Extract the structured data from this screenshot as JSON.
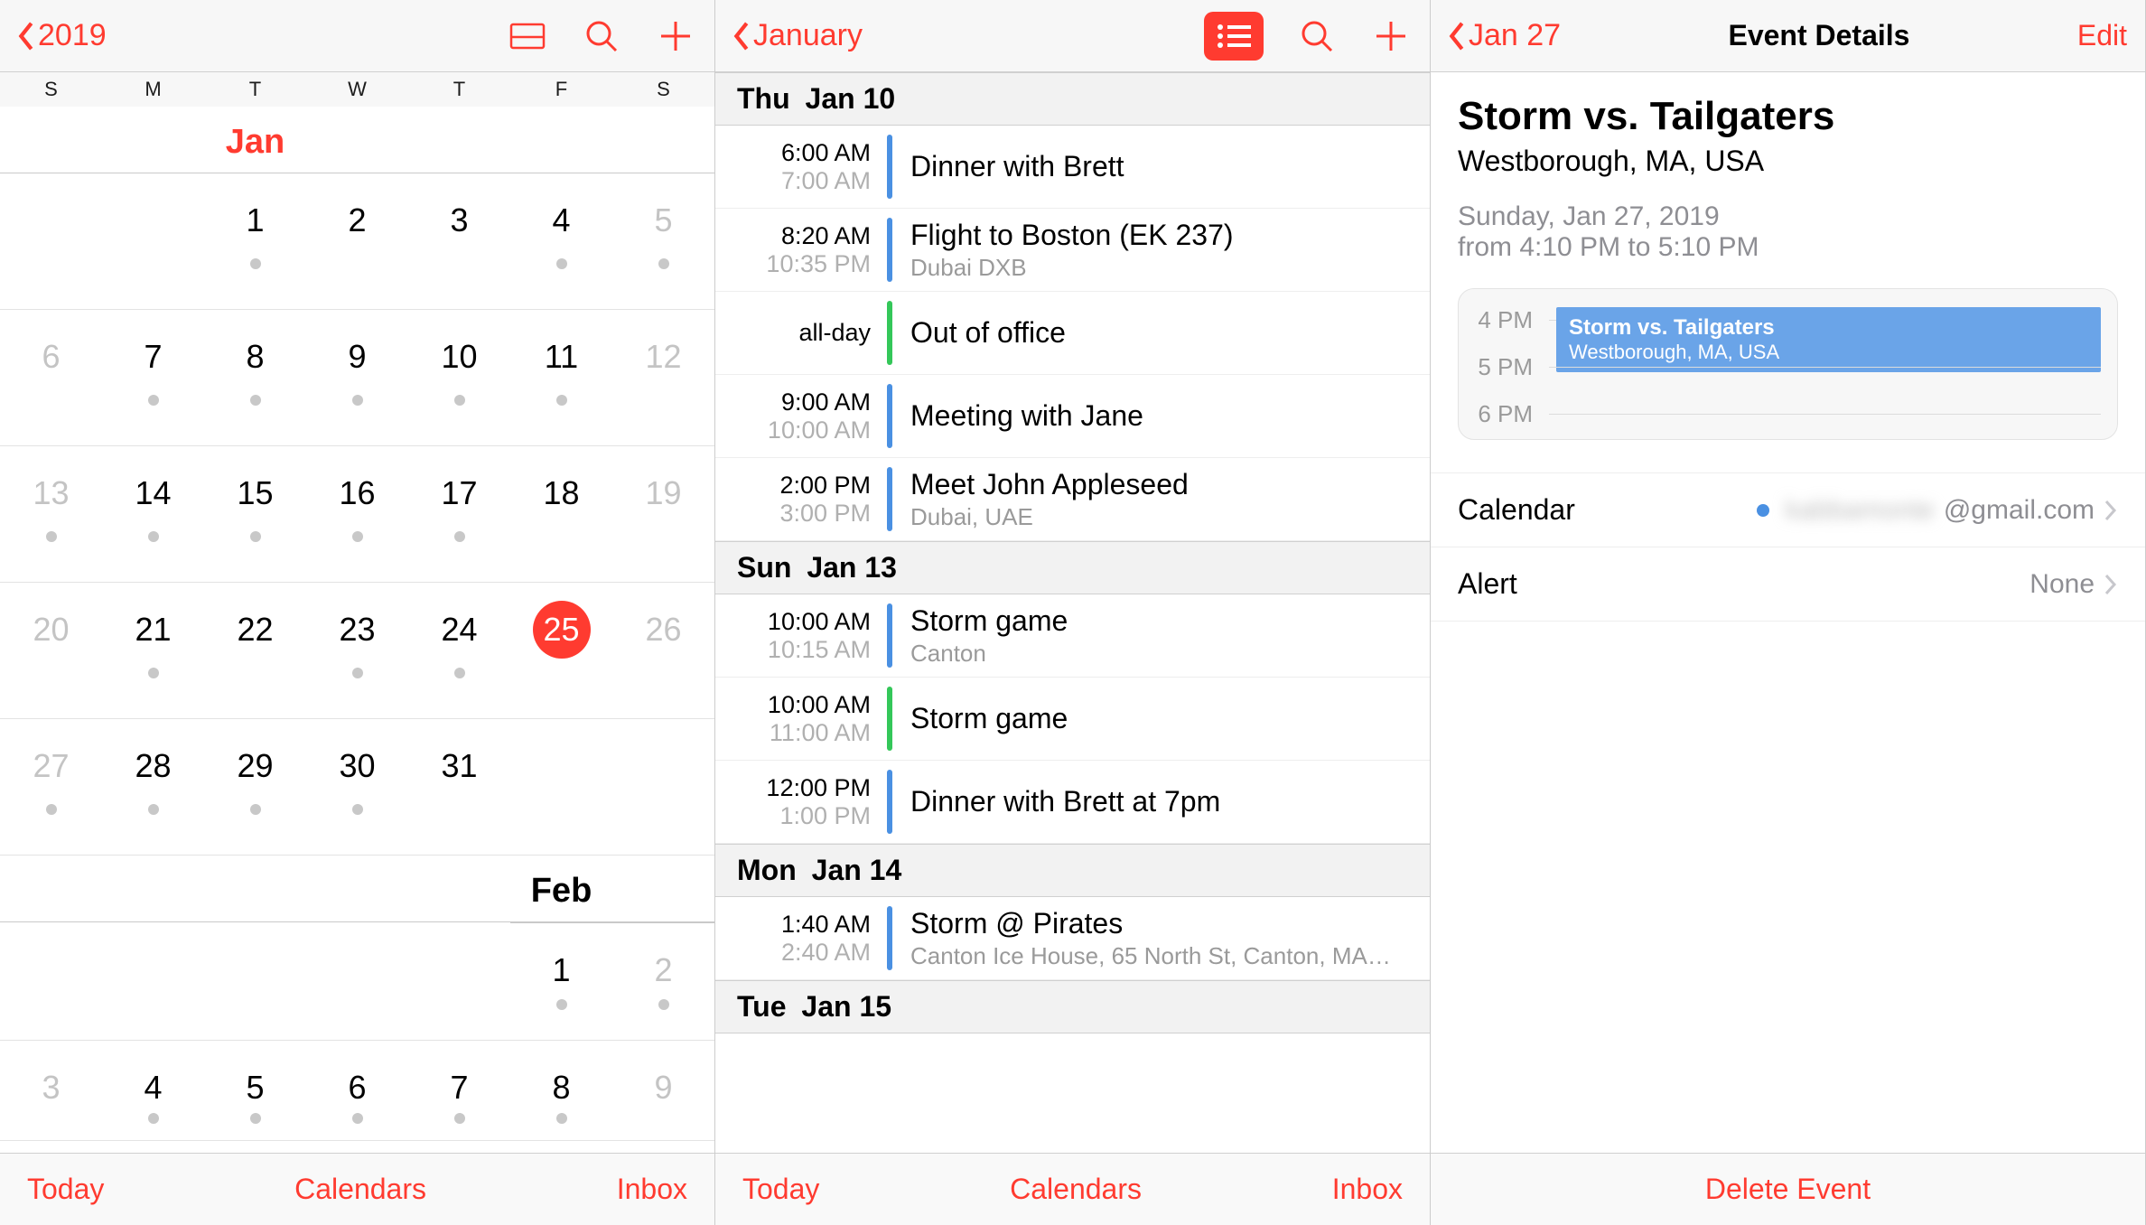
{
  "panel1": {
    "back_label": "2019",
    "weekdays": [
      "S",
      "M",
      "T",
      "W",
      "T",
      "F",
      "S"
    ],
    "month1": "Jan",
    "month2": "Feb",
    "weeks_jan": [
      {
        "offset": 2,
        "days": [
          {
            "n": "1",
            "dot": true
          },
          {
            "n": "2"
          },
          {
            "n": "3"
          },
          {
            "n": "4",
            "dot": true
          },
          {
            "n": "5",
            "gray": true,
            "dot": true
          }
        ]
      },
      {
        "days": [
          {
            "n": "6",
            "gray": true
          },
          {
            "n": "7",
            "dot": true
          },
          {
            "n": "8",
            "dot": true
          },
          {
            "n": "9",
            "dot": true
          },
          {
            "n": "10",
            "dot": true
          },
          {
            "n": "11",
            "dot": true
          },
          {
            "n": "12",
            "gray": true
          }
        ]
      },
      {
        "days": [
          {
            "n": "13",
            "gray": true,
            "dot": true
          },
          {
            "n": "14",
            "dot": true
          },
          {
            "n": "15",
            "dot": true
          },
          {
            "n": "16",
            "dot": true
          },
          {
            "n": "17",
            "dot": true
          },
          {
            "n": "18"
          },
          {
            "n": "19",
            "gray": true
          }
        ]
      },
      {
        "days": [
          {
            "n": "20",
            "gray": true
          },
          {
            "n": "21",
            "dot": true
          },
          {
            "n": "22"
          },
          {
            "n": "23",
            "dot": true
          },
          {
            "n": "24",
            "dot": true
          },
          {
            "n": "25",
            "today": true
          },
          {
            "n": "26",
            "gray": true
          }
        ]
      },
      {
        "days": [
          {
            "n": "27",
            "gray": true,
            "dot": true
          },
          {
            "n": "28",
            "dot": true
          },
          {
            "n": "29",
            "dot": true
          },
          {
            "n": "30",
            "dot": true
          },
          {
            "n": "31"
          }
        ]
      }
    ],
    "weeks_feb": [
      {
        "offset": 5,
        "days": [
          {
            "n": "1",
            "dot": true
          },
          {
            "n": "2",
            "gray": true,
            "dot": true
          }
        ]
      },
      {
        "days": [
          {
            "n": "3",
            "gray": true
          },
          {
            "n": "4",
            "dot": true
          },
          {
            "n": "5",
            "dot": true
          },
          {
            "n": "6",
            "dot": true
          },
          {
            "n": "7",
            "dot": true
          },
          {
            "n": "8",
            "dot": true
          },
          {
            "n": "9",
            "gray": true
          }
        ]
      }
    ],
    "toolbar": {
      "today": "Today",
      "calendars": "Calendars",
      "inbox": "Inbox"
    }
  },
  "panel2": {
    "back_label": "January",
    "days": [
      {
        "dow": "Thu",
        "date": "Jan 10",
        "events": [
          {
            "t1": "6:00 AM",
            "t2": "7:00 AM",
            "color": "blue",
            "title": "Dinner with Brett"
          },
          {
            "t1": "8:20 AM",
            "t2": "10:35 PM",
            "color": "blue",
            "title": "Flight to Boston (EK 237)",
            "loc": "Dubai DXB"
          },
          {
            "t1": "all-day",
            "t2": "",
            "color": "green",
            "title": "Out of office"
          },
          {
            "t1": "9:00 AM",
            "t2": "10:00 AM",
            "color": "blue",
            "title": "Meeting with Jane"
          },
          {
            "t1": "2:00 PM",
            "t2": "3:00 PM",
            "color": "blue",
            "title": "Meet John Appleseed",
            "loc": "Dubai, UAE"
          }
        ]
      },
      {
        "dow": "Sun",
        "date": "Jan 13",
        "events": [
          {
            "t1": "10:00 AM",
            "t2": "10:15 AM",
            "color": "blue",
            "title": "Storm game",
            "loc": "Canton"
          },
          {
            "t1": "10:00 AM",
            "t2": "11:00 AM",
            "color": "green",
            "title": "Storm game"
          },
          {
            "t1": "12:00 PM",
            "t2": "1:00 PM",
            "color": "blue",
            "title": "Dinner with Brett at 7pm"
          }
        ]
      },
      {
        "dow": "Mon",
        "date": "Jan 14",
        "events": [
          {
            "t1": "1:40 AM",
            "t2": "2:40 AM",
            "color": "blue",
            "title": "Storm @ Pirates",
            "loc": "Canton Ice House, 65 North St, Canton, MA…"
          }
        ]
      },
      {
        "dow": "Tue",
        "date": "Jan 15",
        "events": []
      }
    ],
    "toolbar": {
      "today": "Today",
      "calendars": "Calendars",
      "inbox": "Inbox"
    }
  },
  "panel3": {
    "back_label": "Jan 27",
    "title": "Event Details",
    "edit": "Edit",
    "event_title": "Storm vs. Tailgaters",
    "event_location": "Westborough, MA, USA",
    "event_date": "Sunday, Jan 27, 2019",
    "event_time": "from 4:10 PM to 5:10 PM",
    "timeline": {
      "labels": [
        "4 PM",
        "5 PM",
        "6 PM"
      ],
      "evt_title": "Storm vs. Tailgaters",
      "evt_loc": "Westborough, MA, USA"
    },
    "rows": {
      "calendar_label": "Calendar",
      "calendar_value_blurred": "kabbamonte",
      "calendar_suffix": "@gmail.com",
      "alert_label": "Alert",
      "alert_value": "None"
    },
    "delete": "Delete Event"
  }
}
